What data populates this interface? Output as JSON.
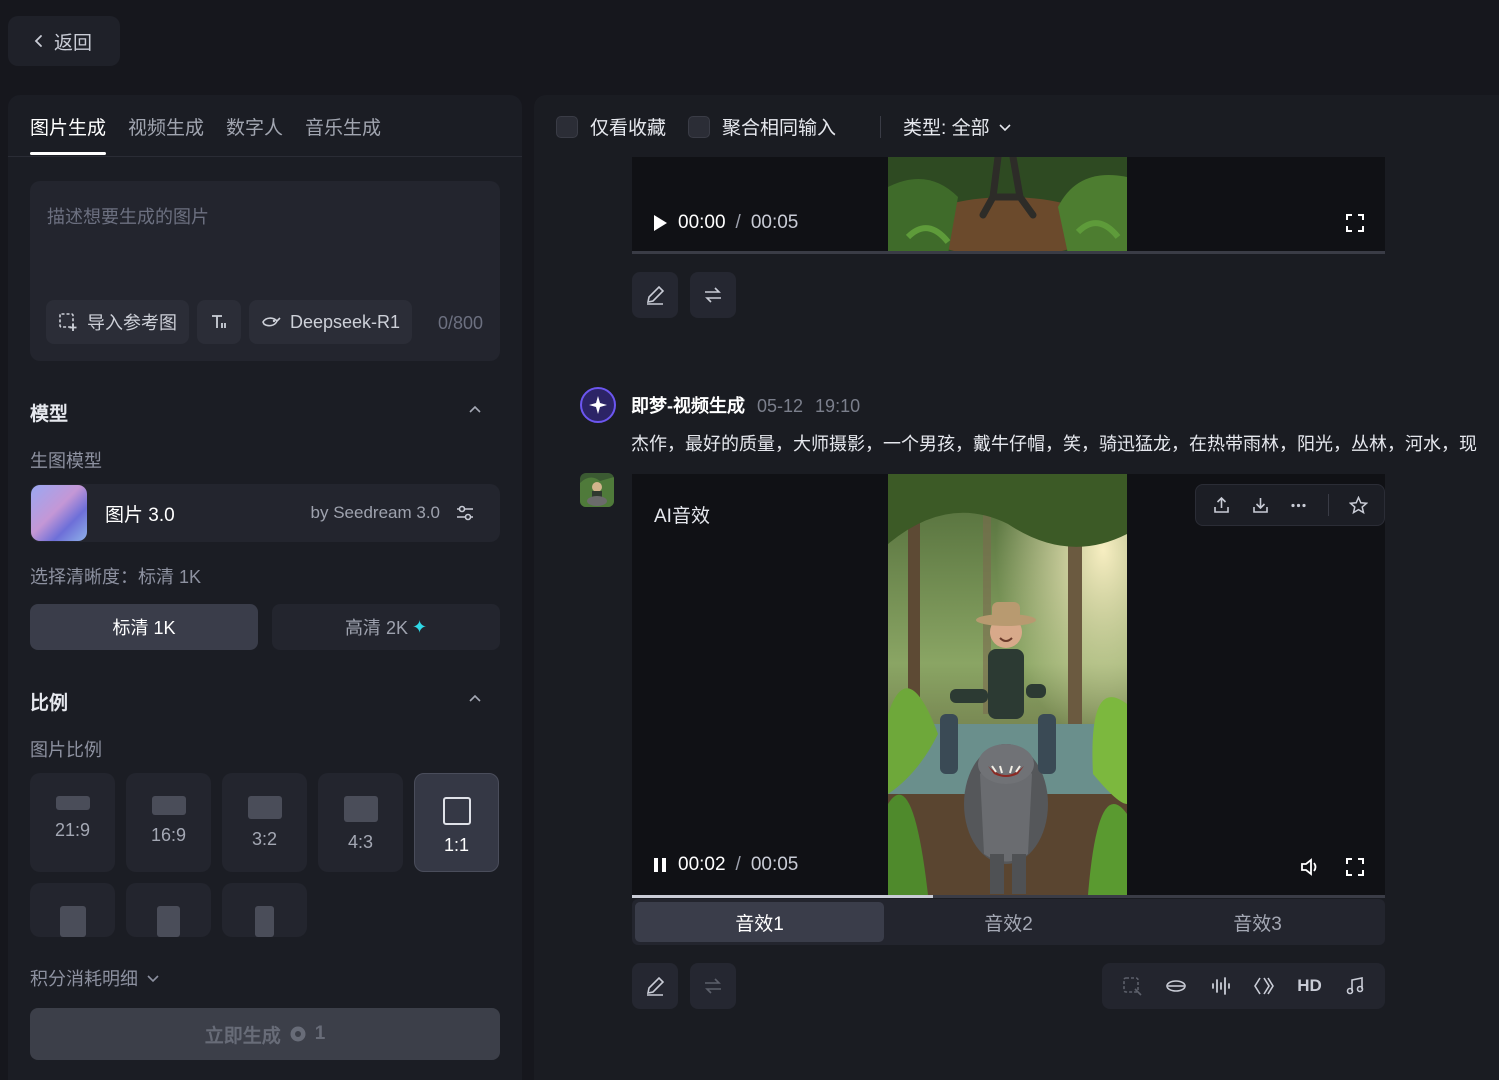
{
  "back": {
    "label": "返回"
  },
  "left": {
    "tabs": [
      {
        "label": "图片生成",
        "active": true
      },
      {
        "label": "视频生成"
      },
      {
        "label": "数字人"
      },
      {
        "label": "音乐生成"
      }
    ],
    "prompt": {
      "placeholder": "描述想要生成的图片",
      "import_ref": "导入参考图",
      "deepseek": "Deepseek-R1",
      "char_count": "0/800"
    },
    "model_section": {
      "title": "模型",
      "sub_label": "生图模型",
      "model_name": "图片 3.0",
      "model_by": "by Seedream 3.0",
      "resolution_label": "选择清晰度：标清 1K",
      "res_sd": "标清 1K",
      "res_hd": "高清 2K"
    },
    "ratio_section": {
      "title": "比例",
      "sub_label": "图片比例",
      "ratios": [
        "21:9",
        "16:9",
        "3:2",
        "4:3",
        "1:1"
      ],
      "selected": "1:1"
    },
    "cost_detail": "积分消耗明细",
    "generate": {
      "label": "立即生成",
      "cost": "1"
    }
  },
  "right": {
    "filters": {
      "favorites_only": "仅看收藏",
      "merge_same": "聚合相同输入",
      "type": "类型: 全部"
    },
    "top_video": {
      "current": "00:00",
      "duration": "00:05"
    },
    "message": {
      "author": "即梦-视频生成",
      "date": "05-12",
      "time": "19:10",
      "prompt": "杰作，最好的质量，大师摄影，一个男孩，戴牛仔帽，笑，骑迅猛龙，在热带雨林，阳光，丛林，河水，现"
    },
    "main_video": {
      "label": "AI音效",
      "current": "00:02",
      "duration": "00:05",
      "progress": 0.4
    },
    "sfx_tabs": [
      "音效1",
      "音效2",
      "音效3"
    ],
    "hd_label": "HD"
  },
  "colors": {
    "background": "#16171d",
    "panel": "#1b1d24",
    "accent_cyan": "#2fd8e6",
    "avatar_purple": "#6c56f0"
  }
}
